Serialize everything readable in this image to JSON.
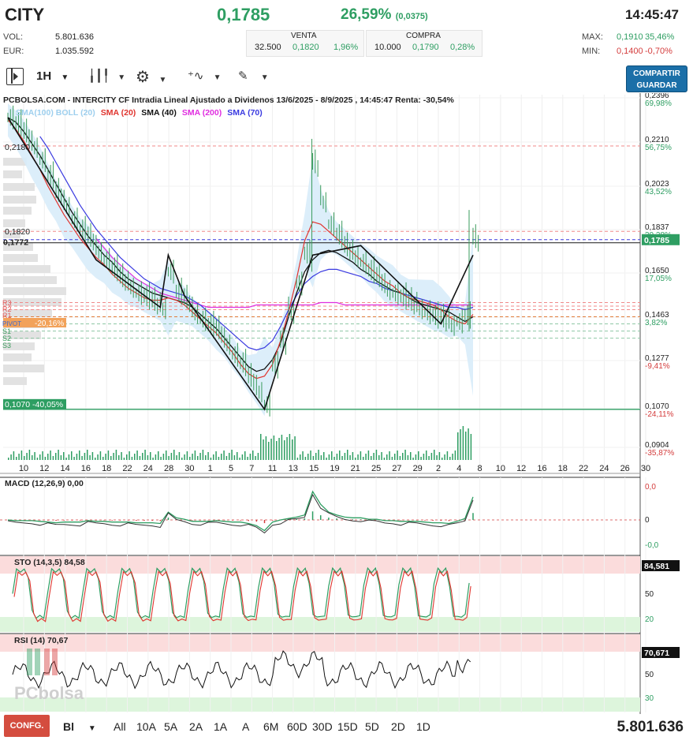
{
  "header": {
    "ticker": "CITY",
    "price": "0,1785",
    "change_pct": "26,59%",
    "change_abs": "(0,0375)",
    "time": "14:45:47"
  },
  "stats": {
    "vol_label": "VOL:",
    "vol_value": "5.801.636",
    "eur_label": "EUR:",
    "eur_value": "1.035.592",
    "max_label": "MAX:",
    "max_value": "0,1910",
    "max_pct": "35,46%",
    "min_label": "MIN:",
    "min_value": "0,1400",
    "min_pct": "-0,70%"
  },
  "orderbook": {
    "sell_label": "VENTA",
    "buy_label": "COMPRA",
    "sell": {
      "qty": "32.500",
      "price": "0,1820",
      "pct": "1,96%"
    },
    "buy": {
      "qty": "10.000",
      "price": "0,1790",
      "pct": "0,28%"
    }
  },
  "toolbar": {
    "interval": "1H",
    "share_line1": "COMPARTIR",
    "share_line2": "GUARDAR"
  },
  "chart_title": "PCBOLSA.COM - INTERCITY CF Intradia Lineal Ajustado a Dividenos 13/6/2025 - 8/9/2025 , 14:45:47 Renta: -30,54%",
  "legend": [
    {
      "label": "SMA(100) BOLL (20)",
      "color": "#9ecfee"
    },
    {
      "label": "SMA (20)",
      "color": "#e0342e"
    },
    {
      "label": "SMA (40)",
      "color": "#111111"
    },
    {
      "label": "SMA (200)",
      "color": "#e02ee0"
    },
    {
      "label": "SMA (70)",
      "color": "#3a3ae0"
    }
  ],
  "price_axis": [
    {
      "price": "0,2396",
      "pct": "69,98%",
      "y": 124,
      "pc": "green"
    },
    {
      "price": "0,2210",
      "pct": "56,75%",
      "y": 180,
      "pc": "green"
    },
    {
      "price": "0,2023",
      "pct": "43,52%",
      "y": 236,
      "pc": "green"
    },
    {
      "price": "0,1837",
      "pct": "30,28%",
      "y": 291,
      "pc": "green"
    },
    {
      "price": "0,1650",
      "pct": "17,05%",
      "y": 346,
      "pc": "green"
    },
    {
      "price": "0,1463",
      "pct": "3,82%",
      "y": 402,
      "pc": "green"
    },
    {
      "price": "0,1277",
      "pct": "-9,41%",
      "y": 457,
      "pc": "red"
    },
    {
      "price": "0,1070",
      "pct": "-24,11%",
      "y": 518,
      "pc": "red"
    },
    {
      "price": "0,0904",
      "pct": "-35,87%",
      "y": 567,
      "pc": "red"
    }
  ],
  "current_price_tag": "0,1785",
  "left_labels": {
    "l1": "0,2180",
    "l2": "0,1820",
    "l3": "0,1772",
    "l4": "0,1070 -40,05%",
    "l5": "-20,16%",
    "r3": "R3",
    "r2": "R2",
    "r1": "R1",
    "pivot": "PIVOT",
    "s1": "S1",
    "s2": "S2",
    "s3": "S3"
  },
  "x_axis": [
    "10",
    "12",
    "14",
    "16",
    "18",
    "22",
    "24",
    "28",
    "30",
    "1",
    "5",
    "7",
    "11",
    "13",
    "15",
    "19",
    "21",
    "25",
    "27",
    "29",
    "2",
    "4",
    "8",
    "10",
    "12",
    "16",
    "18",
    "22",
    "24",
    "26",
    "30"
  ],
  "macd": {
    "label": "MACD (12,26,9)",
    "value": "0,00",
    "axis": [
      "0,0",
      "0",
      "-0,0"
    ]
  },
  "sto": {
    "label": "STO (14,3,5)",
    "value": "84,58",
    "tag": "84,581",
    "axis": [
      "50",
      "20"
    ]
  },
  "rsi": {
    "label": "RSI (14)",
    "value": "70,67",
    "tag": "70,671",
    "axis": [
      "50",
      "30"
    ]
  },
  "watermark": "PCbolsa",
  "bottom": {
    "config": "CONFG.",
    "scale": "Bl",
    "periods": [
      "All",
      "10A",
      "5A",
      "2A",
      "1A",
      "A",
      "6M",
      "60D",
      "30D",
      "15D",
      "5D",
      "2D",
      "1D"
    ],
    "volume": "5.801.636"
  },
  "chart_data": {
    "type": "line",
    "title": "PCBOLSA.COM - INTERCITY CF Intradia Lineal Ajustado a Dividenos 13/6/2025 - 8/9/2025 , 14:45:47 Renta: -30,54%",
    "ylim": [
      0.085,
      0.2396
    ],
    "price": [
      0.23,
      0.227,
      0.223,
      0.218,
      0.212,
      0.205,
      0.198,
      0.193,
      0.187,
      0.182,
      0.179,
      0.174,
      0.17,
      0.166,
      0.162,
      0.159,
      0.156,
      0.154,
      0.152,
      0.15,
      0.165,
      0.156,
      0.153,
      0.148,
      0.145,
      0.142,
      0.14,
      0.135,
      0.13,
      0.126,
      0.12,
      0.115,
      0.109,
      0.125,
      0.135,
      0.148,
      0.16,
      0.172,
      0.21,
      0.195,
      0.185,
      0.18,
      0.175,
      0.172,
      0.169,
      0.165,
      0.162,
      0.158,
      0.156,
      0.154,
      0.152,
      0.15,
      0.148,
      0.146,
      0.145,
      0.143,
      0.144,
      0.146,
      0.1785
    ],
    "sma20": [
      0.229,
      0.225,
      0.22,
      0.214,
      0.208,
      0.201,
      0.195,
      0.189,
      0.184,
      0.179,
      0.175,
      0.171,
      0.168,
      0.164,
      0.161,
      0.158,
      0.156,
      0.154,
      0.153,
      0.153,
      0.154,
      0.153,
      0.151,
      0.148,
      0.145,
      0.142,
      0.139,
      0.135,
      0.131,
      0.126,
      0.122,
      0.12,
      0.121,
      0.126,
      0.136,
      0.148,
      0.162,
      0.178,
      0.186,
      0.185,
      0.182,
      0.179,
      0.176,
      0.173,
      0.17,
      0.167,
      0.164,
      0.161,
      0.159,
      0.156,
      0.154,
      0.153,
      0.152,
      0.151,
      0.149,
      0.146,
      0.144,
      0.143,
      0.147
    ],
    "sma40": [
      0.23,
      0.228,
      0.224,
      0.219,
      0.214,
      0.208,
      0.202,
      0.196,
      0.19,
      0.185,
      0.18,
      0.176,
      0.172,
      0.169,
      0.165,
      0.162,
      0.16,
      0.158,
      0.156,
      0.155,
      0.154,
      0.153,
      0.152,
      0.15,
      0.147,
      0.144,
      0.141,
      0.137,
      0.133,
      0.129,
      0.125,
      0.123,
      0.124,
      0.128,
      0.135,
      0.146,
      0.156,
      0.165,
      0.17,
      0.173,
      0.174,
      0.173,
      0.171,
      0.169,
      0.166,
      0.164,
      0.161,
      0.159,
      0.157,
      0.156,
      0.154,
      0.152,
      0.151,
      0.15,
      0.149,
      0.148,
      0.146,
      0.144,
      0.146
    ],
    "sma70": [
      null,
      null,
      null,
      null,
      0.222,
      0.217,
      0.211,
      0.205,
      0.199,
      0.193,
      0.188,
      0.183,
      0.179,
      0.175,
      0.171,
      0.168,
      0.165,
      0.162,
      0.16,
      0.158,
      0.157,
      0.156,
      0.155,
      0.153,
      0.151,
      0.148,
      0.145,
      0.142,
      0.139,
      0.136,
      0.133,
      0.132,
      0.133,
      0.136,
      0.142,
      0.149,
      0.155,
      0.16,
      0.163,
      0.165,
      0.166,
      0.166,
      0.165,
      0.164,
      0.163,
      0.161,
      0.16,
      0.158,
      0.157,
      0.156,
      0.155,
      0.154,
      0.153,
      0.152,
      0.151,
      0.15,
      0.15,
      0.149,
      0.15
    ],
    "sma200": [
      null,
      null,
      null,
      null,
      null,
      null,
      null,
      null,
      null,
      null,
      null,
      0.179,
      0.175,
      0.171,
      0.168,
      0.165,
      0.162,
      0.16,
      0.158,
      0.156,
      0.155,
      0.154,
      0.153,
      0.152,
      0.151,
      0.15,
      0.15,
      0.15,
      0.15,
      0.15,
      0.15,
      0.151,
      0.151,
      0.151,
      0.151,
      0.151,
      0.151,
      0.151,
      0.151,
      0.152,
      0.152,
      0.152,
      0.151,
      0.151,
      0.151,
      0.151,
      0.151,
      0.151,
      0.151,
      0.151,
      0.151,
      0.151,
      0.151,
      0.151,
      0.151,
      0.151,
      0.151,
      0.151,
      0.151
    ],
    "zigzag": [
      [
        0,
        0.23
      ],
      [
        11,
        0.17
      ],
      [
        19,
        0.15
      ],
      [
        20,
        0.172
      ],
      [
        22,
        0.155
      ],
      [
        32,
        0.107
      ],
      [
        38,
        0.172
      ],
      [
        44,
        0.176
      ],
      [
        54,
        0.143
      ],
      [
        58,
        0.172
      ]
    ],
    "h_levels": {
      "r3": 0.152,
      "pivot": 0.147,
      "s1": 0.143,
      "s2": 0.14,
      "s3": 0.137,
      "support": 0.107,
      "resistance": 0.218,
      "top_line": 0.1772,
      "last": 0.1785
    }
  }
}
